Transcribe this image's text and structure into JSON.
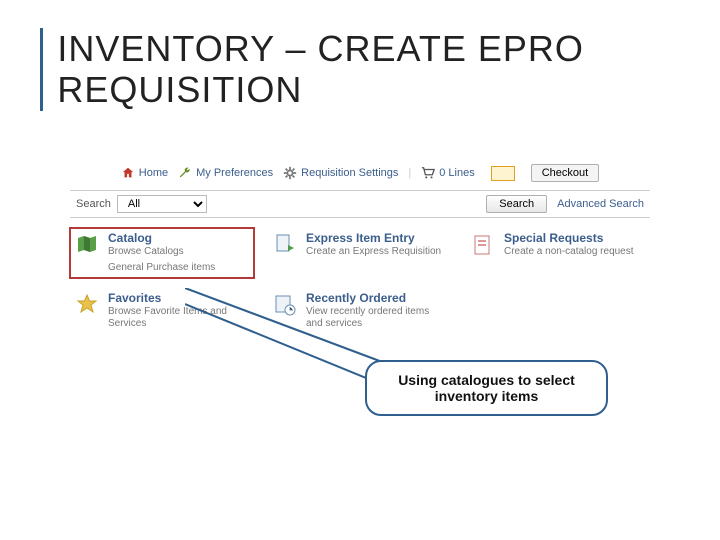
{
  "title": "INVENTORY – CREATE EPRO REQUISITION",
  "nav": {
    "home": "Home",
    "prefs": "My Preferences",
    "reqset": "Requisition Settings",
    "lines": "0 Lines",
    "checkout": "Checkout"
  },
  "search": {
    "label": "Search",
    "scope": "All",
    "button": "Search",
    "advanced": "Advanced Search"
  },
  "tiles": {
    "catalog": {
      "hd": "Catalog",
      "sub": "Browse Catalogs",
      "extra": "General Purchase items"
    },
    "express": {
      "hd": "Express Item Entry",
      "sub": "Create an Express Requisition"
    },
    "special": {
      "hd": "Special Requests",
      "sub": "Create a non-catalog request"
    },
    "fav": {
      "hd": "Favorites",
      "sub": "Browse Favorite Items and Services"
    },
    "recent": {
      "hd": "Recently Ordered",
      "sub": "View recently ordered items and services"
    }
  },
  "callout": "Using catalogues to select inventory items"
}
